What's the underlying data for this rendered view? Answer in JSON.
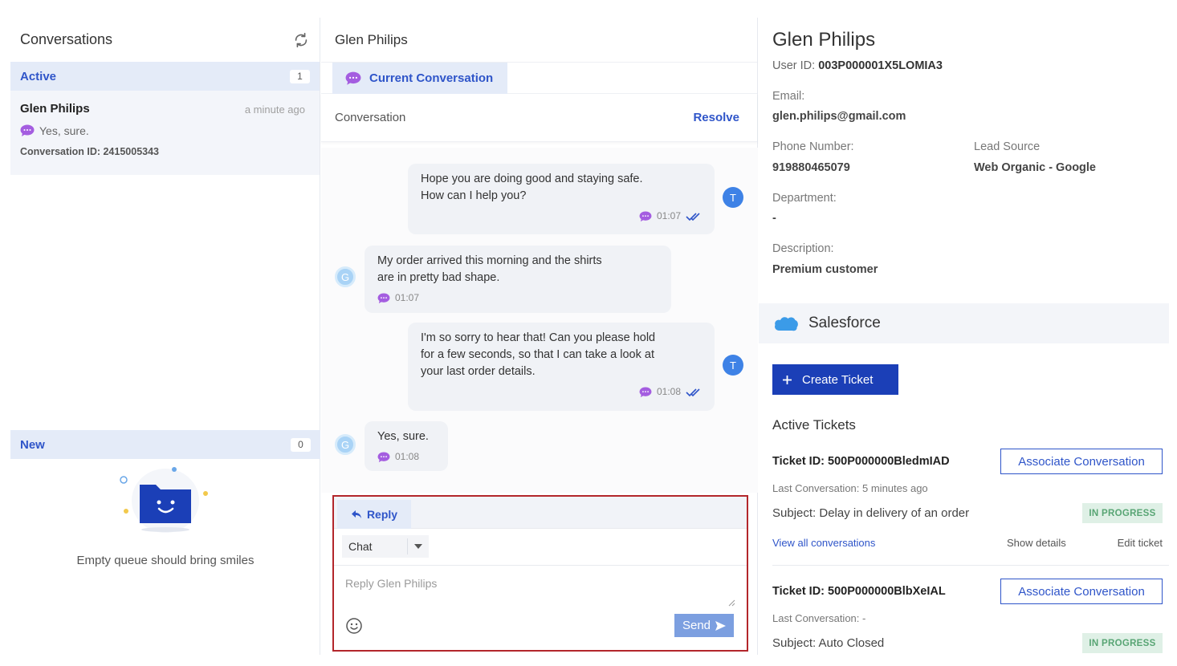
{
  "left": {
    "title": "Conversations",
    "active": {
      "label": "Active",
      "count": "1"
    },
    "conversation": {
      "name": "Glen Philips",
      "time": "a minute ago",
      "last_message": "Yes, sure.",
      "conversation_id": "Conversation ID: 2415005343"
    },
    "new": {
      "label": "New",
      "count": "0"
    },
    "empty_text": "Empty queue should bring smiles"
  },
  "middle": {
    "title": "Glen Philips",
    "tab": "Current Conversation",
    "conversation_label": "Conversation",
    "resolve": "Resolve",
    "messages": [
      {
        "from": "agent",
        "avatar": "T",
        "lines": [
          "Hope you are doing good and staying safe.",
          "How can I help you?"
        ],
        "time": "01:07"
      },
      {
        "from": "customer",
        "avatar": "G",
        "lines": [
          "My order arrived this morning and the shirts",
          "are in pretty bad shape."
        ],
        "time": "01:07"
      },
      {
        "from": "agent",
        "avatar": "T",
        "lines": [
          "I'm so sorry to hear that! Can you please hold",
          "for a few seconds, so that I can take a look at",
          "your last order details."
        ],
        "time": "01:08"
      },
      {
        "from": "customer",
        "avatar": "G",
        "lines": [
          "Yes, sure."
        ],
        "time": "01:08"
      }
    ],
    "reply": {
      "tab_label": "Reply",
      "channel": "Chat",
      "placeholder": "Reply Glen Philips",
      "send_label": "Send"
    }
  },
  "right": {
    "name": "Glen Philips",
    "user_id_label": "User ID:",
    "user_id": "003P000001X5LOMIA3",
    "email_label": "Email:",
    "email": "glen.philips@gmail.com",
    "phone_label": "Phone Number:",
    "phone": "919880465079",
    "lead_source_label": "Lead Source",
    "lead_source": "Web Organic - Google",
    "department_label": "Department:",
    "department": "-",
    "description_label": "Description:",
    "description": "Premium customer",
    "salesforce_label": "Salesforce",
    "create_ticket": "Create Ticket",
    "active_tickets_title": "Active Tickets",
    "tickets": [
      {
        "id": "Ticket ID: 500P000000BledmIAD",
        "associate": "Associate Conversation",
        "last_conversation": "Last Conversation: 5 minutes ago",
        "subject": "Subject: Delay in delivery of an order",
        "status": "IN PROGRESS",
        "view_all": "View all conversations",
        "show_details": "Show details",
        "edit": "Edit ticket"
      },
      {
        "id": "Ticket ID: 500P000000BlbXeIAL",
        "associate": "Associate Conversation",
        "last_conversation": "Last Conversation: -",
        "subject": "Subject: Auto Closed",
        "status": "IN PROGRESS"
      }
    ]
  },
  "colors": {
    "accent": "#2f55c9",
    "primary_button": "#1b3fb7",
    "highlight_border": "#b3262b",
    "status_bg": "#dff0e6",
    "status_text": "#58a574"
  },
  "icons": [
    "refresh-icon",
    "chat-bubble-icon",
    "double-check-icon",
    "reply-arrow-icon",
    "emoji-icon",
    "send-arrow-icon",
    "salesforce-cloud-icon",
    "plus-icon",
    "empty-folder-icon"
  ]
}
